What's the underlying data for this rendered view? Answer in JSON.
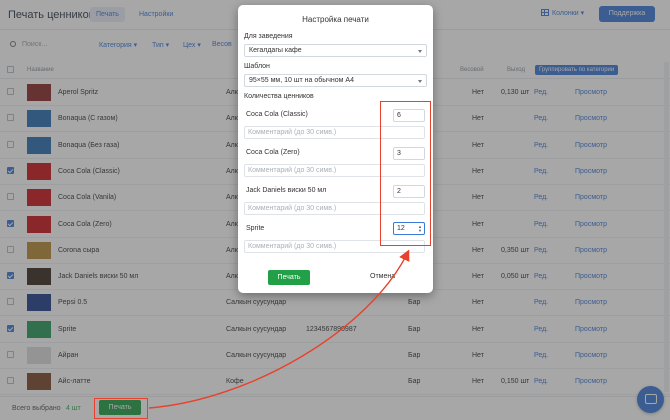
{
  "header": {
    "title": "Печать ценников",
    "tabs": [
      "Печать",
      "Настройки"
    ],
    "columns_label": "Колонки",
    "support_label": "Поддержка"
  },
  "filters": {
    "search_placeholder": "Поиск...",
    "items": [
      "Категория",
      "Тип",
      "Цех",
      "Весов"
    ]
  },
  "table": {
    "headers": {
      "name": "Название",
      "weight": "Весовой",
      "yield": "Выход"
    },
    "group_label": "Группировать по категории",
    "rows": [
      {
        "name": "Aperol Spritz",
        "cat": "Алк",
        "code": "",
        "shop": "",
        "weight": "Нет",
        "yield": "0,130 шт",
        "edit": "Ред.",
        "view": "Просмотр",
        "checked": false,
        "thumb": "#8a2b2b"
      },
      {
        "name": "Bonaqua (С газом)",
        "cat": "Алк",
        "code": "",
        "shop": "",
        "weight": "Нет",
        "yield": "",
        "edit": "Ред.",
        "view": "Просмотр",
        "checked": false,
        "thumb": "#2a6fb4"
      },
      {
        "name": "Bonaqua (Без газа)",
        "cat": "Алк",
        "code": "",
        "shop": "",
        "weight": "Нет",
        "yield": "",
        "edit": "Ред.",
        "view": "Просмотр",
        "checked": false,
        "thumb": "#2a6fb4"
      },
      {
        "name": "Coca Cola (Classic)",
        "cat": "Алк",
        "code": "",
        "shop": "",
        "weight": "Нет",
        "yield": "",
        "edit": "Ред.",
        "view": "Просмотр",
        "checked": true,
        "thumb": "#c8171e"
      },
      {
        "name": "Coca Cola (Vanila)",
        "cat": "Алк",
        "code": "",
        "shop": "",
        "weight": "Нет",
        "yield": "",
        "edit": "Ред.",
        "view": "Просмотр",
        "checked": false,
        "thumb": "#c8171e"
      },
      {
        "name": "Coca Cola (Zero)",
        "cat": "Алк",
        "code": "",
        "shop": "",
        "weight": "Нет",
        "yield": "",
        "edit": "Ред.",
        "view": "Просмотр",
        "checked": true,
        "thumb": "#c8171e"
      },
      {
        "name": "Corona сыра",
        "cat": "Алк",
        "code": "",
        "shop": "",
        "weight": "Нет",
        "yield": "0,350 шт",
        "edit": "Ред.",
        "view": "Просмотр",
        "checked": false,
        "thumb": "#b78b3a"
      },
      {
        "name": "Jack Daniels виски 50 мл",
        "cat": "Алк",
        "code": "",
        "shop": "",
        "weight": "Нет",
        "yield": "0,050 шт",
        "edit": "Ред.",
        "view": "Просмотр",
        "checked": true,
        "thumb": "#3a2a20"
      },
      {
        "name": "Pepsi 0.5",
        "cat": "Салкын суусундар",
        "code": "",
        "shop": "Бар",
        "weight": "Нет",
        "yield": "",
        "edit": "Ред.",
        "view": "Просмотр",
        "checked": false,
        "thumb": "#1f3f8a"
      },
      {
        "name": "Sprite",
        "cat": "Салкын суусундар",
        "code": "1234567890987",
        "shop": "Бар",
        "weight": "Нет",
        "yield": "",
        "edit": "Ред.",
        "view": "Просмотр",
        "checked": true,
        "thumb": "#2a9a5a"
      },
      {
        "name": "Айран",
        "cat": "Салкын суусундар",
        "code": "",
        "shop": "Бар",
        "weight": "Нет",
        "yield": "",
        "edit": "Ред.",
        "view": "Просмотр",
        "checked": false,
        "thumb": "#dcdcdc"
      },
      {
        "name": "Айс-латте",
        "cat": "Кофе",
        "code": "",
        "shop": "Бар",
        "weight": "Нет",
        "yield": "0,150 шт",
        "edit": "Ред.",
        "view": "Просмотр",
        "checked": false,
        "thumb": "#7a4a2a"
      }
    ]
  },
  "footer": {
    "selected_label": "Всего выбрано",
    "selected_count": "4 шт",
    "print_label": "Печать"
  },
  "modal": {
    "title": "Настройка печати",
    "venue_label": "Для заведения",
    "venue_value": "Кегалдагы кафе",
    "template_label": "Шаблон",
    "template_value": "95×55 мм, 10 шт на обычном А4",
    "qty_label": "Количества ценников",
    "comment_placeholder": "Комментарий (до 30 симв.)",
    "items": [
      {
        "name": "Coca Cola (Classic)",
        "qty": "6"
      },
      {
        "name": "Coca Cola (Zero)",
        "qty": "3"
      },
      {
        "name": "Jack Daniels виски 50 мл",
        "qty": "2"
      },
      {
        "name": "Sprite",
        "qty": "12"
      }
    ],
    "print_label": "Печать",
    "cancel_label": "Отмена"
  },
  "colors": {
    "accent": "#3b78d8",
    "green": "#21a048",
    "annotation": "#e8412c"
  }
}
